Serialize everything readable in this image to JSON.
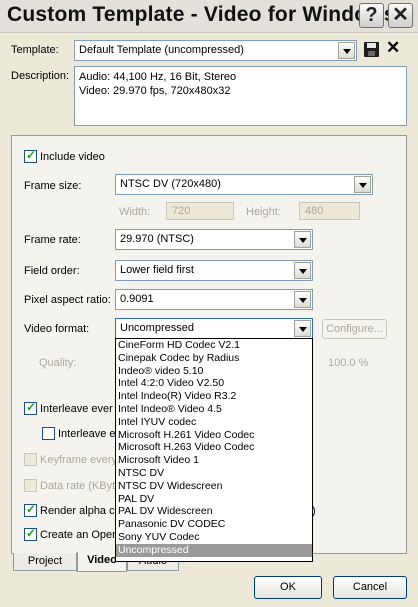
{
  "window": {
    "title": "Custom Template - Video for Windows"
  },
  "titlebar": {
    "help_glyph": "?",
    "close_glyph": "✕"
  },
  "template": {
    "label": "Template:",
    "value": "Default Template (uncompressed)"
  },
  "description": {
    "label": "Description:",
    "lines": [
      "Audio: 44,100 Hz, 16 Bit, Stereo",
      "Video: 29.970 fps, 720x480x32"
    ]
  },
  "include_video": {
    "label": "Include video",
    "checked": true
  },
  "frame_size": {
    "label": "Frame size:",
    "value": "NTSC DV (720x480)",
    "width_label": "Width:",
    "width_value": "720",
    "height_label": "Height:",
    "height_value": "480"
  },
  "frame_rate": {
    "label": "Frame rate:",
    "value": "29.970 (NTSC)"
  },
  "field_order": {
    "label": "Field order:",
    "value": "Lower field first"
  },
  "pixel_aspect": {
    "label": "Pixel aspect ratio:",
    "value": "0.9091"
  },
  "video_format": {
    "label": "Video format:",
    "value": "Uncompressed",
    "configure_label": "Configure...",
    "options": [
      "CineForm HD Codec V2.1",
      "Cinepak Codec by Radius",
      "Indeo® video 5.10",
      "Intel 4:2:0 Video V2.50",
      "Intel Indeo(R) Video R3.2",
      "Intel Indeo® Video 4.5",
      "Intel IYUV codec",
      "Microsoft H.261 Video Codec",
      "Microsoft H.263 Video Codec",
      "Microsoft Video 1",
      "NTSC DV",
      "NTSC DV Widescreen",
      "PAL DV",
      "PAL DV Widescreen",
      "Panasonic DV CODEC",
      "Sony YUV Codec",
      "Uncompressed"
    ],
    "selected": "Uncompressed"
  },
  "quality": {
    "label": "Quality:",
    "value": "100.0 %"
  },
  "checkboxes": {
    "interleave": {
      "label": "Interleave ever",
      "checked": true
    },
    "interleave_sub": {
      "label": "Interleave e",
      "checked": false
    },
    "keyframe": {
      "label": "Keyframe every",
      "checked": false
    },
    "data_rate": {
      "label": "Data rate (KByt",
      "checked": false
    },
    "render_alpha": {
      "label": "Render alpha ch",
      "checked": true,
      "suffix": ")"
    },
    "create_open": {
      "label": "Create an Open",
      "checked": true
    }
  },
  "tabs": [
    {
      "label": "Project",
      "active": false
    },
    {
      "label": "Video",
      "active": true
    },
    {
      "label": "Audio",
      "active": false
    }
  ],
  "buttons": {
    "ok": "OK",
    "cancel": "Cancel"
  },
  "colors": {
    "selected_option_bg": "#9a9a9a",
    "checkmark": "#21a121",
    "dialog_bg": "#ece9d8"
  }
}
